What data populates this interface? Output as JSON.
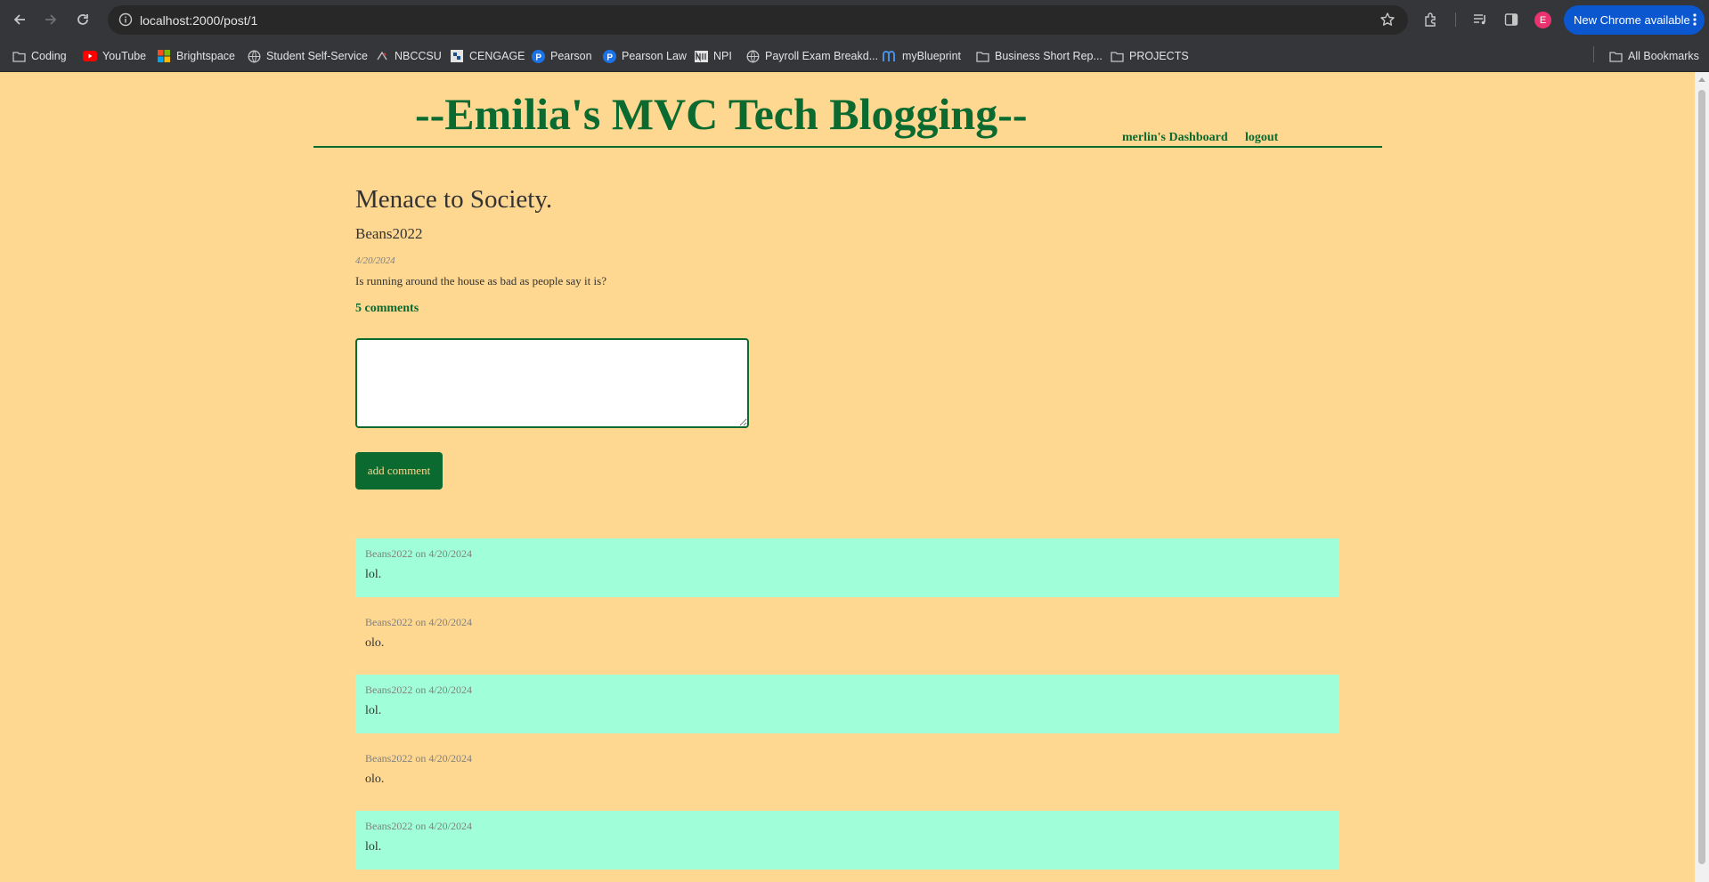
{
  "browser": {
    "url": "localhost:2000/post/1",
    "profile_initial": "E",
    "update_label": "New Chrome available",
    "bookmarks": [
      {
        "label": "Coding",
        "icon": "folder-icon"
      },
      {
        "label": "YouTube",
        "icon": "youtube-icon"
      },
      {
        "label": "Brightspace",
        "icon": "brightspace-icon"
      },
      {
        "label": "Student Self-Service",
        "icon": "globe-icon"
      },
      {
        "label": "NBCCSU",
        "icon": "nbccsu-icon"
      },
      {
        "label": "CENGAGE",
        "icon": "cengage-icon"
      },
      {
        "label": "Pearson",
        "icon": "pearson-icon"
      },
      {
        "label": "Pearson Law",
        "icon": "pearson-icon"
      },
      {
        "label": "NPI",
        "icon": "npi-icon"
      },
      {
        "label": "Payroll Exam Breakd...",
        "icon": "globe-icon"
      },
      {
        "label": "myBlueprint",
        "icon": "myblueprint-icon"
      },
      {
        "label": "Business Short Rep...",
        "icon": "folder-icon"
      },
      {
        "label": "PROJECTS",
        "icon": "folder-icon"
      }
    ],
    "all_bookmarks_label": "All Bookmarks"
  },
  "site": {
    "title": "--Emilia's MVC Tech Blogging--",
    "nav": {
      "dashboard": "merlin's Dashboard",
      "logout": "logout"
    }
  },
  "post": {
    "title": "Menace to Society.",
    "author": "Beans2022",
    "date": "4/20/2024",
    "body": "Is running around the house as bad as people say it is?",
    "comment_count": "5 comments"
  },
  "comment_form": {
    "value": "",
    "button_label": "add comment"
  },
  "comments": [
    {
      "meta": "Beans2022 on 4/20/2024",
      "text": "lol."
    },
    {
      "meta": "Beans2022 on 4/20/2024",
      "text": "olo."
    },
    {
      "meta": "Beans2022 on 4/20/2024",
      "text": "lol."
    },
    {
      "meta": "Beans2022 on 4/20/2024",
      "text": "olo."
    },
    {
      "meta": "Beans2022 on 4/20/2024",
      "text": "lol."
    }
  ],
  "colors": {
    "page_bg": "#fed791",
    "accent_green": "#0a6a2f",
    "comment_highlight": "#a0ffd8"
  }
}
